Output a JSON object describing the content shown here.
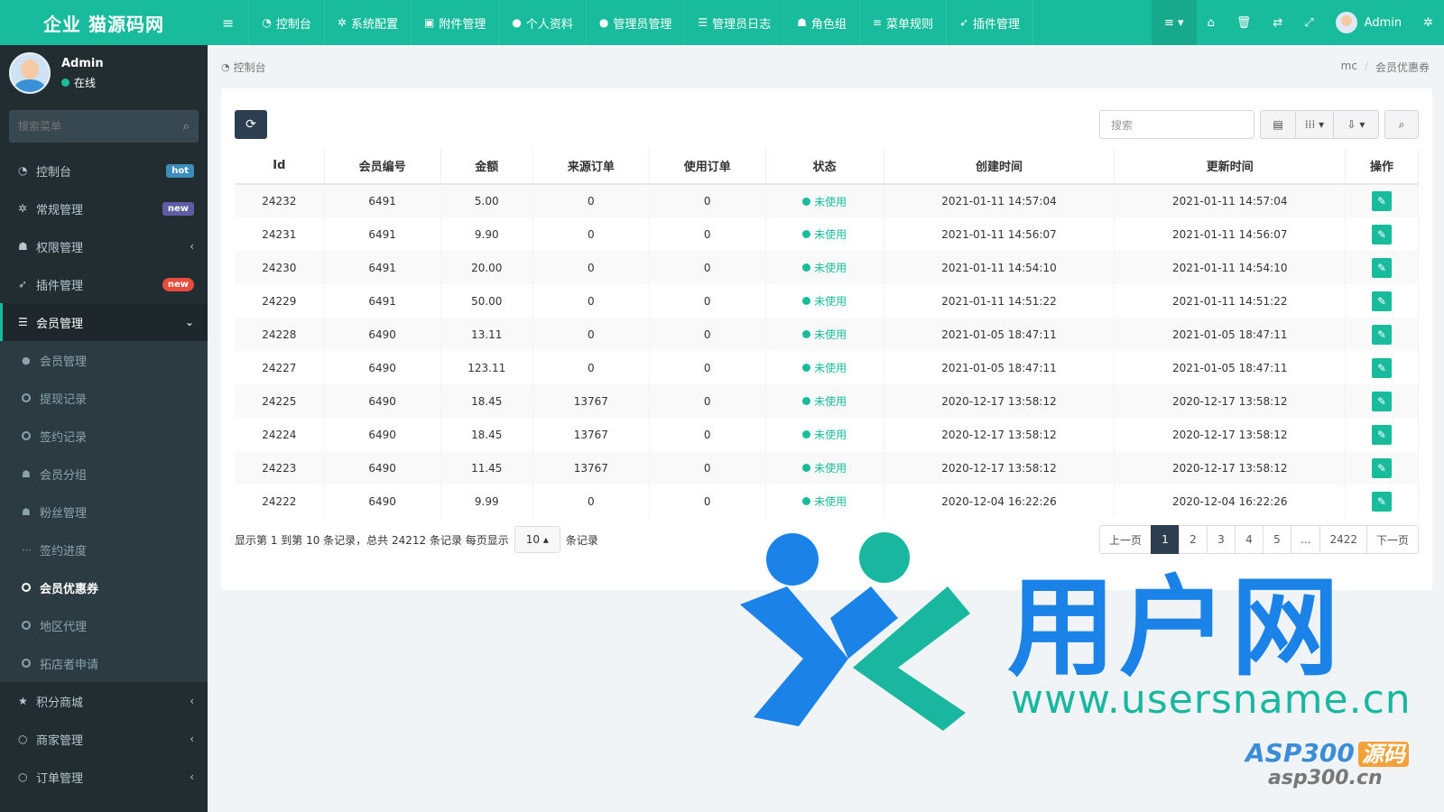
{
  "header": {
    "logo": "企业 猫源码网",
    "nav": [
      {
        "icon": "dashboard-icon",
        "glyph": "◔",
        "label": "控制台"
      },
      {
        "icon": "gear-icon",
        "glyph": "✲",
        "label": "系统配置"
      },
      {
        "icon": "file-icon",
        "glyph": "▣",
        "label": "附件管理"
      },
      {
        "icon": "user-icon",
        "glyph": "●",
        "label": "个人资料"
      },
      {
        "icon": "user-icon",
        "glyph": "●",
        "label": "管理员管理"
      },
      {
        "icon": "list-icon",
        "glyph": "☰",
        "label": "管理员日志"
      },
      {
        "icon": "group-icon",
        "glyph": "☗",
        "label": "角色组"
      },
      {
        "icon": "bars-icon",
        "glyph": "≡",
        "label": "菜单规则"
      },
      {
        "icon": "rocket-icon",
        "glyph": "➶",
        "label": "插件管理"
      }
    ],
    "right": {
      "menu_glyph": "≡ ▾",
      "home": "⌂",
      "trash": "🗑",
      "translate": "⇄",
      "fullscreen": "⤢",
      "user": "Admin",
      "settings": "✲"
    }
  },
  "sidebar": {
    "user": {
      "name": "Admin",
      "status": "在线"
    },
    "search_placeholder": "搜索菜单",
    "items_top": [
      {
        "name": "sidebar-item-dashboard",
        "glyph": "◔",
        "label": "控制台",
        "badge": "hot",
        "badge_class": "hot"
      },
      {
        "name": "sidebar-item-general",
        "glyph": "✲",
        "label": "常规管理",
        "badge": "new",
        "badge_class": "new-purple"
      },
      {
        "name": "sidebar-item-auth",
        "glyph": "☗",
        "label": "权限管理",
        "caret": "‹"
      },
      {
        "name": "sidebar-item-addon",
        "glyph": "➶",
        "label": "插件管理",
        "badge": "new",
        "badge_class": "new-red"
      }
    ],
    "active": {
      "glyph": "☰",
      "label": "会员管理",
      "caret": "⌄"
    },
    "sub": [
      {
        "type": "icon",
        "glyph": "●",
        "label": "会员管理"
      },
      {
        "type": "ring",
        "label": "提现记录"
      },
      {
        "type": "ring",
        "label": "签约记录"
      },
      {
        "type": "icon",
        "glyph": "☗",
        "label": "会员分组"
      },
      {
        "type": "icon",
        "glyph": "☗",
        "label": "粉丝管理"
      },
      {
        "type": "icon",
        "glyph": "⋯",
        "label": "签约进度"
      },
      {
        "type": "ring",
        "label": "会员优惠券",
        "current": true
      },
      {
        "type": "ring",
        "label": "地区代理"
      },
      {
        "type": "ring",
        "label": "拓店者申请"
      }
    ],
    "items_bottom": [
      {
        "name": "sidebar-item-points-mall",
        "glyph": "★",
        "label": "积分商城",
        "caret": "‹"
      },
      {
        "name": "sidebar-item-merchant",
        "glyph": "○",
        "label": "商家管理",
        "caret": "‹"
      },
      {
        "name": "sidebar-item-orders",
        "glyph": "○",
        "label": "订单管理",
        "caret": "‹"
      }
    ]
  },
  "breadcrumb": {
    "left": "控制台",
    "right": [
      "mc",
      "会员优惠券"
    ]
  },
  "toolbar": {
    "search_placeholder": "搜索"
  },
  "table": {
    "columns": [
      "Id",
      "会员编号",
      "金额",
      "来源订单",
      "使用订单",
      "状态",
      "创建时间",
      "更新时间",
      "操作"
    ],
    "rows": [
      [
        "24232",
        "6491",
        "5.00",
        "0",
        "0",
        "未使用",
        "2021-01-11 14:57:04",
        "2021-01-11 14:57:04"
      ],
      [
        "24231",
        "6491",
        "9.90",
        "0",
        "0",
        "未使用",
        "2021-01-11 14:56:07",
        "2021-01-11 14:56:07"
      ],
      [
        "24230",
        "6491",
        "20.00",
        "0",
        "0",
        "未使用",
        "2021-01-11 14:54:10",
        "2021-01-11 14:54:10"
      ],
      [
        "24229",
        "6491",
        "50.00",
        "0",
        "0",
        "未使用",
        "2021-01-11 14:51:22",
        "2021-01-11 14:51:22"
      ],
      [
        "24228",
        "6490",
        "13.11",
        "0",
        "0",
        "未使用",
        "2021-01-05 18:47:11",
        "2021-01-05 18:47:11"
      ],
      [
        "24227",
        "6490",
        "123.11",
        "0",
        "0",
        "未使用",
        "2021-01-05 18:47:11",
        "2021-01-05 18:47:11"
      ],
      [
        "24225",
        "6490",
        "18.45",
        "13767",
        "0",
        "未使用",
        "2020-12-17 13:58:12",
        "2020-12-17 13:58:12"
      ],
      [
        "24224",
        "6490",
        "18.45",
        "13767",
        "0",
        "未使用",
        "2020-12-17 13:58:12",
        "2020-12-17 13:58:12"
      ],
      [
        "24223",
        "6490",
        "11.45",
        "13767",
        "0",
        "未使用",
        "2020-12-17 13:58:12",
        "2020-12-17 13:58:12"
      ],
      [
        "24222",
        "6490",
        "9.99",
        "0",
        "0",
        "未使用",
        "2020-12-04 16:22:26",
        "2020-12-04 16:22:26"
      ]
    ]
  },
  "pager": {
    "info_prefix": "显示第 1 到第 10 条记录，总共 24212 条记录 每页显示",
    "page_size": "10 ▴",
    "info_suffix": "条记录",
    "pages": [
      "上一页",
      "1",
      "2",
      "3",
      "4",
      "5",
      "...",
      "2422",
      "下一页"
    ],
    "active_page": "1"
  },
  "watermark": {
    "text_cn": "用户网",
    "url": "www.usersname.cn",
    "asp": "ASP300",
    "asp_badge": "源码",
    "asp_url": "asp300.cn"
  },
  "colors": {
    "header": "#18bc9c",
    "sidebar": "#222d32",
    "accent": "#18bc9c",
    "dark_button": "#2c3e50"
  }
}
